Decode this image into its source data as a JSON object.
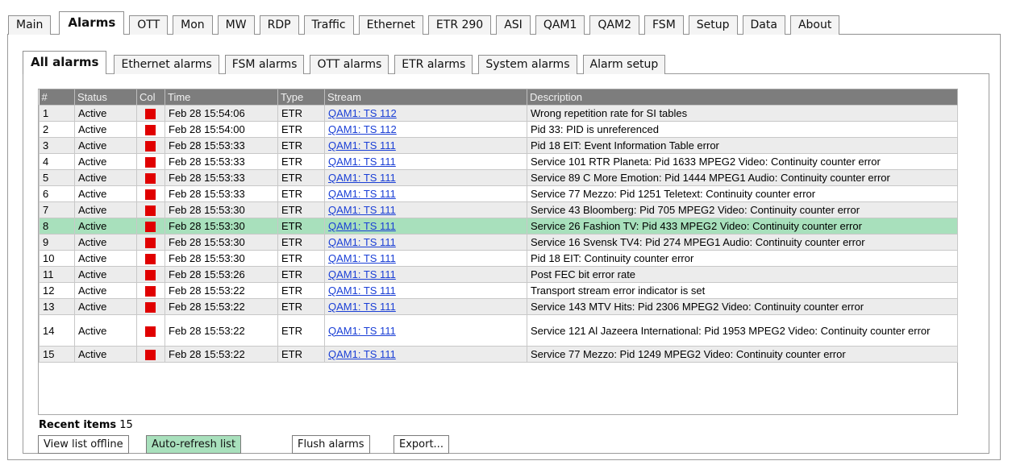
{
  "top_tabs": [
    "Main",
    "Alarms",
    "OTT",
    "Mon",
    "MW",
    "RDP",
    "Traffic",
    "Ethernet",
    "ETR 290",
    "ASI",
    "QAM1",
    "QAM2",
    "FSM",
    "Setup",
    "Data",
    "About"
  ],
  "top_tabs_active": "Alarms",
  "sub_tabs": [
    "All alarms",
    "Ethernet alarms",
    "FSM alarms",
    "OTT alarms",
    "ETR alarms",
    "System alarms",
    "Alarm setup"
  ],
  "sub_tabs_active": "All alarms",
  "table": {
    "headers": [
      "#",
      "Status",
      "Col",
      "Time",
      "Type",
      "Stream",
      "Description"
    ],
    "status_color": "#e00000",
    "selected_row_color": "#a8e0bc",
    "rows": [
      {
        "num": "1",
        "status": "Active",
        "time": "Feb 28 15:54:06",
        "type": "ETR",
        "stream": "QAM1: TS 112",
        "desc": "Wrong repetition rate for SI tables"
      },
      {
        "num": "2",
        "status": "Active",
        "time": "Feb 28 15:54:00",
        "type": "ETR",
        "stream": "QAM1: TS 112",
        "desc": "Pid 33: PID is unreferenced"
      },
      {
        "num": "3",
        "status": "Active",
        "time": "Feb 28 15:53:33",
        "type": "ETR",
        "stream": "QAM1: TS 111",
        "desc": "Pid 18 EIT: Event Information Table error"
      },
      {
        "num": "4",
        "status": "Active",
        "time": "Feb 28 15:53:33",
        "type": "ETR",
        "stream": "QAM1: TS 111",
        "desc": "Service 101 RTR Planeta: Pid 1633 MPEG2 Video: Continuity counter error"
      },
      {
        "num": "5",
        "status": "Active",
        "time": "Feb 28 15:53:33",
        "type": "ETR",
        "stream": "QAM1: TS 111",
        "desc": "Service 89 C More Emotion: Pid 1444 MPEG1 Audio: Continuity counter error"
      },
      {
        "num": "6",
        "status": "Active",
        "time": "Feb 28 15:53:33",
        "type": "ETR",
        "stream": "QAM1: TS 111",
        "desc": "Service 77 Mezzo: Pid 1251 Teletext: Continuity counter error"
      },
      {
        "num": "7",
        "status": "Active",
        "time": "Feb 28 15:53:30",
        "type": "ETR",
        "stream": "QAM1: TS 111",
        "desc": "Service 43 Bloomberg: Pid 705 MPEG2 Video: Continuity counter error"
      },
      {
        "num": "8",
        "status": "Active",
        "time": "Feb 28 15:53:30",
        "type": "ETR",
        "stream": "QAM1: TS 111",
        "desc": "Service 26 Fashion TV: Pid 433 MPEG2 Video: Continuity counter error",
        "selected": true
      },
      {
        "num": "9",
        "status": "Active",
        "time": "Feb 28 15:53:30",
        "type": "ETR",
        "stream": "QAM1: TS 111",
        "desc": "Service 16 Svensk TV4: Pid 274 MPEG1 Audio: Continuity counter error"
      },
      {
        "num": "10",
        "status": "Active",
        "time": "Feb 28 15:53:30",
        "type": "ETR",
        "stream": "QAM1: TS 111",
        "desc": "Pid 18 EIT: Continuity counter error"
      },
      {
        "num": "11",
        "status": "Active",
        "time": "Feb 28 15:53:26",
        "type": "ETR",
        "stream": "QAM1: TS 111",
        "desc": "Post FEC bit error rate"
      },
      {
        "num": "12",
        "status": "Active",
        "time": "Feb 28 15:53:22",
        "type": "ETR",
        "stream": "QAM1: TS 111",
        "desc": "Transport stream error indicator is set"
      },
      {
        "num": "13",
        "status": "Active",
        "time": "Feb 28 15:53:22",
        "type": "ETR",
        "stream": "QAM1: TS 111",
        "desc": "Service 143 MTV Hits: Pid 2306 MPEG2 Video: Continuity counter error"
      },
      {
        "num": "14",
        "status": "Active",
        "time": "Feb 28 15:53:22",
        "type": "ETR",
        "stream": "QAM1: TS 111",
        "desc": "Service 121 Al Jazeera International: Pid 1953 MPEG2 Video: Continuity counter error",
        "tall": true
      },
      {
        "num": "15",
        "status": "Active",
        "time": "Feb 28 15:53:22",
        "type": "ETR",
        "stream": "QAM1: TS 111",
        "desc": "Service 77 Mezzo: Pid 1249 MPEG2 Video: Continuity counter error"
      }
    ]
  },
  "footer": {
    "recent_label": "Recent items",
    "recent_count": "15",
    "view_offline": "View list offline",
    "auto_refresh": "Auto-refresh list",
    "auto_refresh_active": true,
    "flush": "Flush alarms",
    "export": "Export..."
  }
}
